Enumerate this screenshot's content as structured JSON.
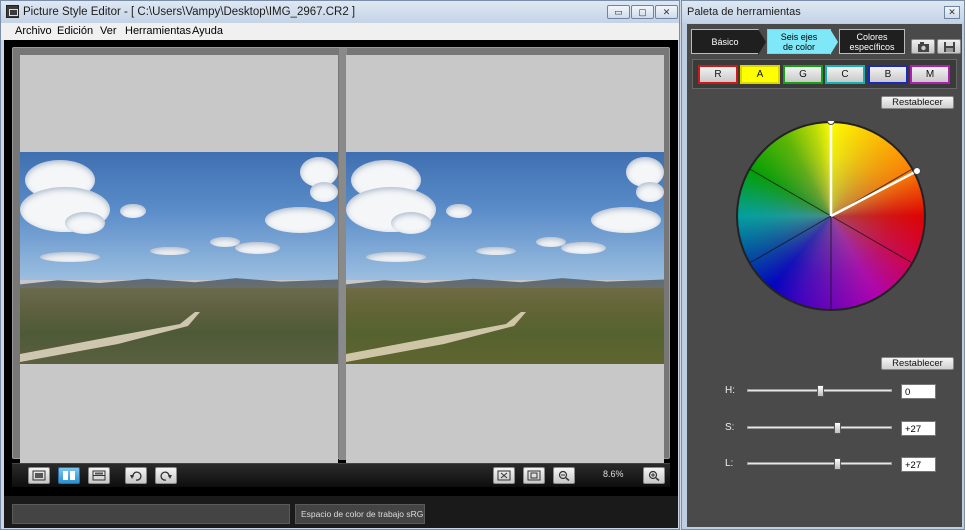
{
  "main_window": {
    "title": "Picture Style Editor - [ C:\\Users\\Vampy\\Desktop\\IMG_2967.CR2 ]",
    "controls": {
      "minimize": "▭",
      "maximize": "▢",
      "close": "✕"
    },
    "menu": [
      "Archivo",
      "Edición",
      "Ver",
      "Herramientas",
      "Ayuda"
    ],
    "toolbar": {
      "zoom_level": "8.6%"
    },
    "status": {
      "left_text": "",
      "color_space": "Espacio de color de trabajo sRGB"
    }
  },
  "palette": {
    "title": "Paleta de herramientas",
    "close": "✕",
    "tabs": [
      {
        "line1": "Básico",
        "line2": "",
        "active": false
      },
      {
        "line1": "Seis ejes",
        "line2": "de color",
        "active": true
      },
      {
        "line1": "Colores",
        "line2": "específicos",
        "active": false
      }
    ],
    "axes": [
      {
        "label": "R",
        "color": "#d01818",
        "selected": false
      },
      {
        "label": "A",
        "color": "#d8d800",
        "selected": true
      },
      {
        "label": "G",
        "color": "#18a018",
        "selected": false
      },
      {
        "label": "C",
        "color": "#18b0b0",
        "selected": false
      },
      {
        "label": "B",
        "color": "#1828c0",
        "selected": false
      },
      {
        "label": "M",
        "color": "#b020b0",
        "selected": false
      }
    ],
    "reset_top": "Restablecer",
    "reset_bottom": "Restablecer",
    "sliders": [
      {
        "label": "H:",
        "value": "0",
        "level": 0.5
      },
      {
        "label": "S:",
        "value": "+27",
        "level": 0.62
      },
      {
        "label": "L:",
        "value": "+27",
        "level": 0.62
      }
    ]
  }
}
